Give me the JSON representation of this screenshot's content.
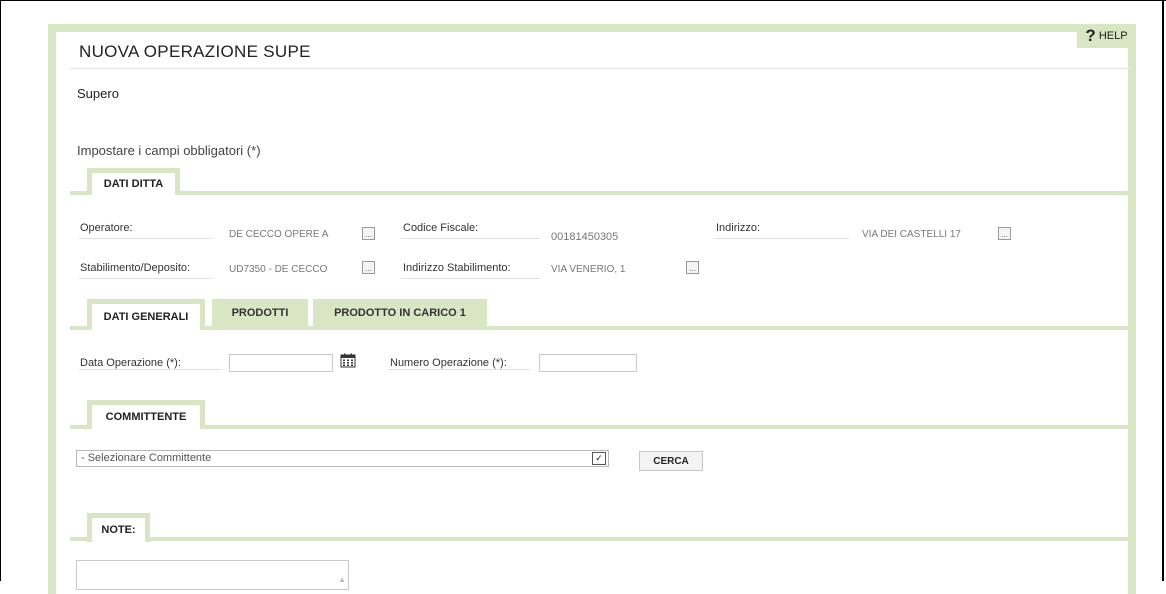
{
  "header": {
    "title": "NUOVA OPERAZIONE SUPE",
    "help_label": "HELP",
    "help_symbol": "?"
  },
  "subtitle": "Supero",
  "hint": "Impostare i campi obbligatori (*)",
  "section_dati_ditta": {
    "tab_label": "DATI DITTA",
    "operatore_label": "Operatore:",
    "operatore_value": "DE CECCO OPERE A",
    "codice_fiscale_label": "Codice Fiscale:",
    "codice_fiscale_value": "00181450305",
    "indirizzo_label": "Indirizzo:",
    "indirizzo_value": "VIA DEI CASTELLI 17",
    "stabilimento_label": "Stabilimento/Deposito:",
    "stabilimento_value": "UD7350 - DE CECCO",
    "indirizzo_stab_label": "Indirizzo Stabilimento:",
    "indirizzo_stab_value": "VIA VENERIO, 1",
    "ellipsis": "..."
  },
  "tabs": {
    "dati_generali": "DATI GENERALI",
    "prodotti": "PRODOTTI",
    "prodotto_in_carico": "PRODOTTO IN CARICO 1"
  },
  "dati_generali": {
    "data_operazione_label": "Data Operazione (*):",
    "data_operazione_value": "",
    "numero_operazione_label": "Numero Operazione (*):",
    "numero_operazione_value": ""
  },
  "committente": {
    "tab_label": "COMMITTENTE",
    "select_value": "- Selezionare Committente",
    "search_button": "CERCA"
  },
  "note": {
    "tab_label": "NOTE:",
    "value": ""
  },
  "colors": {
    "accent_green": "#d8e6c4",
    "tab_inactive": "#d8e6c4"
  }
}
